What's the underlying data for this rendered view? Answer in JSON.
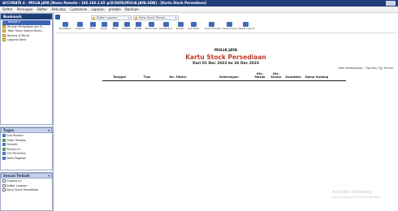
{
  "window": {
    "title": "ACCURATE 4 - MULIA JAYA  [Nama Remote : 192.168.1.65 @\\D\\DATA\\MULIA JAYA.GDB]  - [Kartu Stock Persediaan]"
  },
  "menubar": [
    "Daftar",
    "Persiapan",
    "Daftar",
    "Aktivitas",
    "Customize",
    "Laporan",
    "Jendela",
    "Bantuan"
  ],
  "sidebar": {
    "bookmark_title": "Bookmark",
    "bookmark_items": [
      {
        "label": "Tambah ▾",
        "selected": true
      },
      {
        "label": "Rincian Persediaan per G..."
      },
      {
        "label": "Total Tiang Gading Divisi..."
      },
      {
        "label": "Barang di Minus"
      },
      {
        "label": "Laporan Kasir"
      }
    ],
    "task_title": "Tugas",
    "task_items": [
      "Giro Mundur",
      "Order Terbuka",
      "Tersortir",
      "Pelung Ini",
      "Cek Penerima",
      "Salas Pegawai"
    ],
    "recent_title": "Sesuai Terbaik",
    "recent_items": [
      "Gudang Ini",
      "Daftar Laporan",
      "Kartu Stock Persediaan"
    ]
  },
  "tabs": [
    {
      "label": "Daftar Laporan"
    },
    {
      "label": "Kartu Stock Persed..."
    }
  ],
  "toolbar": [
    "Modifikasi",
    "Analisa",
    "Print",
    "Zoom",
    "Balik",
    "Simpan",
    "Email",
    "Memorise",
    "Perbaharui",
    "Desain",
    "Cari Data",
    "Auto Transfer",
    "Save Layout",
    "Reset Layout"
  ],
  "report": {
    "company": "MULIA JAYA",
    "title": "Kartu Stock Persediaan",
    "period": "Dari 01 Dec 2023 ke 26 Dec 2023",
    "filter": "Filter berdasarkan : Tipe Kts; Tgl. Kirrum",
    "columns": [
      "Tanggal",
      "Tipe",
      "No. Faktur",
      "Keterangan",
      "Kts. Masuk",
      "Kts. Keluar",
      "Kuantitas",
      "Nama Gudang"
    ]
  },
  "watermark": {
    "line1": "Activate Windows",
    "line2": "Go to Settings to activate Windows."
  }
}
